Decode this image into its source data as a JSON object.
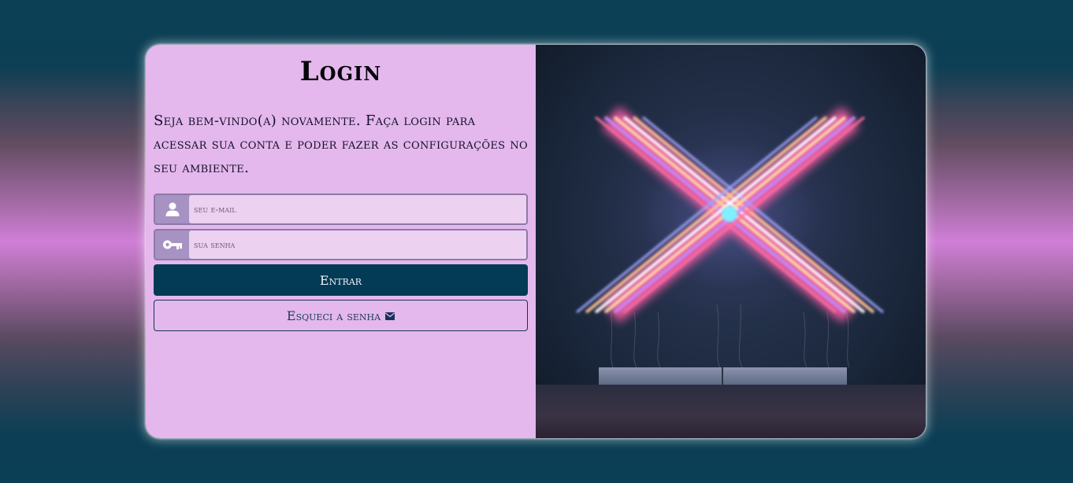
{
  "login": {
    "title": "Login",
    "welcome": "Seja bem-vindo(a) novamente. Faça login para acessar sua conta e poder fazer as configurações no seu ambiente.",
    "email": {
      "placeholder": "seu e-mail",
      "value": ""
    },
    "password": {
      "placeholder": "sua senha",
      "value": ""
    },
    "submit_label": "Entrar",
    "forgot_label": "Esqueci a senha"
  },
  "icons": {
    "email_field": "user-icon",
    "password_field": "key-icon",
    "forgot": "envelope-icon"
  },
  "colors": {
    "background_primary": "#0b3f55",
    "background_accent": "#cf7fd6",
    "panel": "#e4b8ec",
    "button_primary": "#033a56"
  }
}
